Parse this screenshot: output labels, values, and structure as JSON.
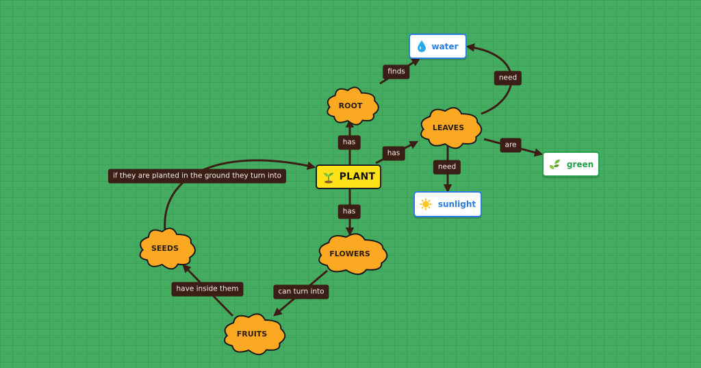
{
  "diagram": {
    "type": "concept-map",
    "central_node": {
      "id": "plant",
      "label": "PLANT",
      "icon": "sprout-icon"
    },
    "cloud_nodes": [
      {
        "id": "root",
        "label": "ROOT"
      },
      {
        "id": "leaves",
        "label": "LEAVES"
      },
      {
        "id": "flowers",
        "label": "FLOWERS"
      },
      {
        "id": "seeds",
        "label": "SEEDS"
      },
      {
        "id": "fruits",
        "label": "FRUITS"
      }
    ],
    "info_nodes": [
      {
        "id": "water",
        "label": "water",
        "icon": "water-drop-icon",
        "color": "#2a7de1"
      },
      {
        "id": "sunlight",
        "label": "sunlight",
        "icon": "sun-icon",
        "color": "#2a7de1"
      },
      {
        "id": "green",
        "label": "green",
        "icon": "leaves-icon",
        "color": "#23a24a"
      }
    ],
    "edges": [
      {
        "from": "plant",
        "to": "root",
        "label": "has"
      },
      {
        "from": "plant",
        "to": "leaves",
        "label": "has"
      },
      {
        "from": "plant",
        "to": "flowers",
        "label": "has"
      },
      {
        "from": "root",
        "to": "water",
        "label": "finds"
      },
      {
        "from": "leaves",
        "to": "water",
        "label": "need"
      },
      {
        "from": "leaves",
        "to": "sunlight",
        "label": "need"
      },
      {
        "from": "leaves",
        "to": "green",
        "label": "are"
      },
      {
        "from": "flowers",
        "to": "fruits",
        "label": "can turn into"
      },
      {
        "from": "fruits",
        "to": "seeds",
        "label": "have inside them"
      },
      {
        "from": "seeds",
        "to": "plant",
        "label": "if they are planted in the ground they turn into"
      }
    ]
  },
  "colors": {
    "background": "#45ad62",
    "cloud_fill": "#fba923",
    "plant_fill": "#ffe21a",
    "edge": "#3b1f16",
    "label_bg": "#3b1f16"
  }
}
